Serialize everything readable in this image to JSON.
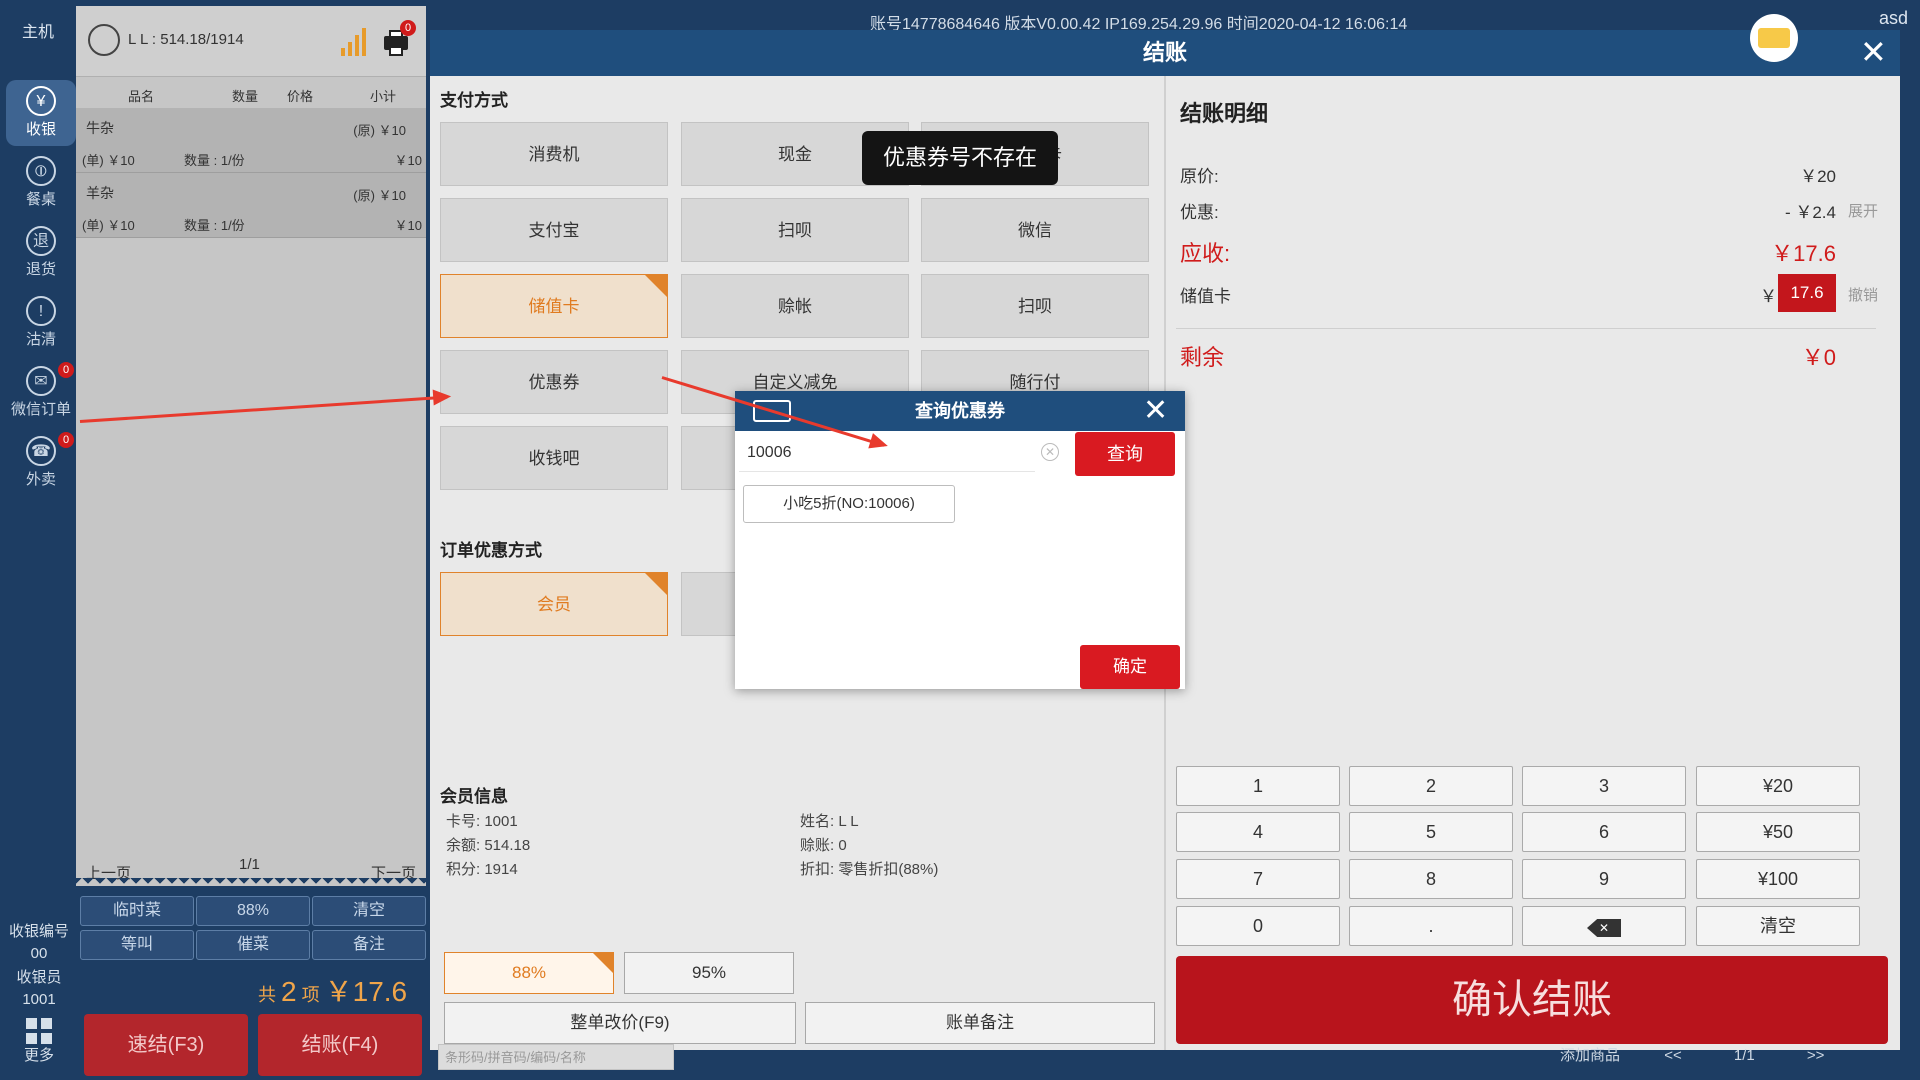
{
  "topbar": {
    "host": "主机",
    "info": "账号14778684646  版本V0.00.42  IP169.254.29.96  时间2020-04-12 16:06:14",
    "user": "asd"
  },
  "nav": [
    {
      "label": "收银",
      "icon": "yen-icon",
      "glyph": "¥",
      "active": true
    },
    {
      "label": "餐桌",
      "icon": "cutlery-icon",
      "glyph": "⦶"
    },
    {
      "label": "退货",
      "icon": "return-icon",
      "glyph": "退"
    },
    {
      "label": "沽清",
      "icon": "warning-icon",
      "glyph": "!"
    },
    {
      "label": "微信订单",
      "icon": "wechat-icon",
      "glyph": "✉",
      "badge": "0"
    },
    {
      "label": "外卖",
      "icon": "delivery-icon",
      "glyph": "☎",
      "badge": "0"
    }
  ],
  "nav_bottom": {
    "cashier_no_label": "收银编号",
    "cashier_no": "00",
    "cashier_label": "收银员",
    "cashier": "1001",
    "more": "更多"
  },
  "receipt": {
    "member_line": "L L : 514.18/1914",
    "printer_badge": "0",
    "columns": [
      "品名",
      "数量",
      "价格",
      "小计"
    ],
    "items": [
      {
        "name": "牛杂",
        "orig": "(原) ￥10",
        "unit": "(单) ￥10",
        "qty": "数量 : 1/份",
        "subtotal": "￥10"
      },
      {
        "name": "羊杂",
        "orig": "(原) ￥10",
        "unit": "(单) ￥10",
        "qty": "数量 : 1/份",
        "subtotal": "￥10"
      }
    ],
    "prev": "上一页",
    "page": "1/1",
    "next": "下一页"
  },
  "quick_buttons": [
    "临时菜",
    "88%",
    "清空",
    "等叫",
    "催菜",
    "备注"
  ],
  "total": {
    "prefix": "共",
    "count": "2",
    "suffix": "项",
    "amount": "￥17.6"
  },
  "quick_settle": "速结(F3)",
  "settle": "结账(F4)",
  "modal": {
    "title": "结账",
    "pay_section": "支付方式",
    "pay_methods": [
      {
        "label": "消费机"
      },
      {
        "label": "现金"
      },
      {
        "label": "卡"
      },
      {
        "label": "支付宝"
      },
      {
        "label": "扫呗"
      },
      {
        "label": "微信"
      },
      {
        "label": "储值卡",
        "selected": true
      },
      {
        "label": "赊帐"
      },
      {
        "label": "扫呗"
      },
      {
        "label": "优惠券"
      },
      {
        "label": "自定义减免"
      },
      {
        "label": "随行付"
      },
      {
        "label": "收钱吧"
      }
    ],
    "order_section": "订单优惠方式",
    "order_discount": "会员",
    "member_section": "会员信息",
    "member": {
      "card": "卡号:  1001",
      "balance": "余额:  514.18",
      "points": "积分:  1914",
      "name": "姓名:  L L",
      "credit": "赊账:  0",
      "discount": "折扣:  零售折扣(88%)"
    },
    "discount_buttons": [
      {
        "label": "88%",
        "selected": true
      },
      {
        "label": "95%"
      }
    ],
    "whole_change": "整单改价(F9)",
    "bill_note": "账单备注",
    "search_placeholder": "条形码/拼音码/编码/名称"
  },
  "detail": {
    "title": "结账明细",
    "original_label": "原价:",
    "original_value": "￥20",
    "discount_label": "优惠:",
    "discount_value": "- ￥2.4",
    "expand": "展开",
    "receivable_label": "应收:",
    "receivable_value": "￥17.6",
    "stored_card_label": "储值卡",
    "stored_card_currency": "￥",
    "stored_card_value": "17.6",
    "revoke": "撤销",
    "remaining_label": "剩余",
    "remaining_value": "￥0"
  },
  "keypad": [
    "1",
    "2",
    "3",
    "¥20",
    "4",
    "5",
    "6",
    "¥50",
    "7",
    "8",
    "9",
    "¥100",
    "0",
    ".",
    "",
    "清空"
  ],
  "confirm": "确认结账",
  "bottom_strip": {
    "add": "添加商品",
    "prev": "<<",
    "page": "1/1",
    "next": ">>"
  },
  "toast": "优惠券号不存在",
  "coupon_dialog": {
    "title": "查询优惠券",
    "input_value": "10006",
    "query": "查询",
    "result": "小吃5折(NO:10006)",
    "ok": "确定"
  },
  "colors": {
    "accent_red": "#d01b1b",
    "selected_orange": "#e0832b",
    "header_blue": "#1f4e7d",
    "background": "#1d3d63"
  }
}
